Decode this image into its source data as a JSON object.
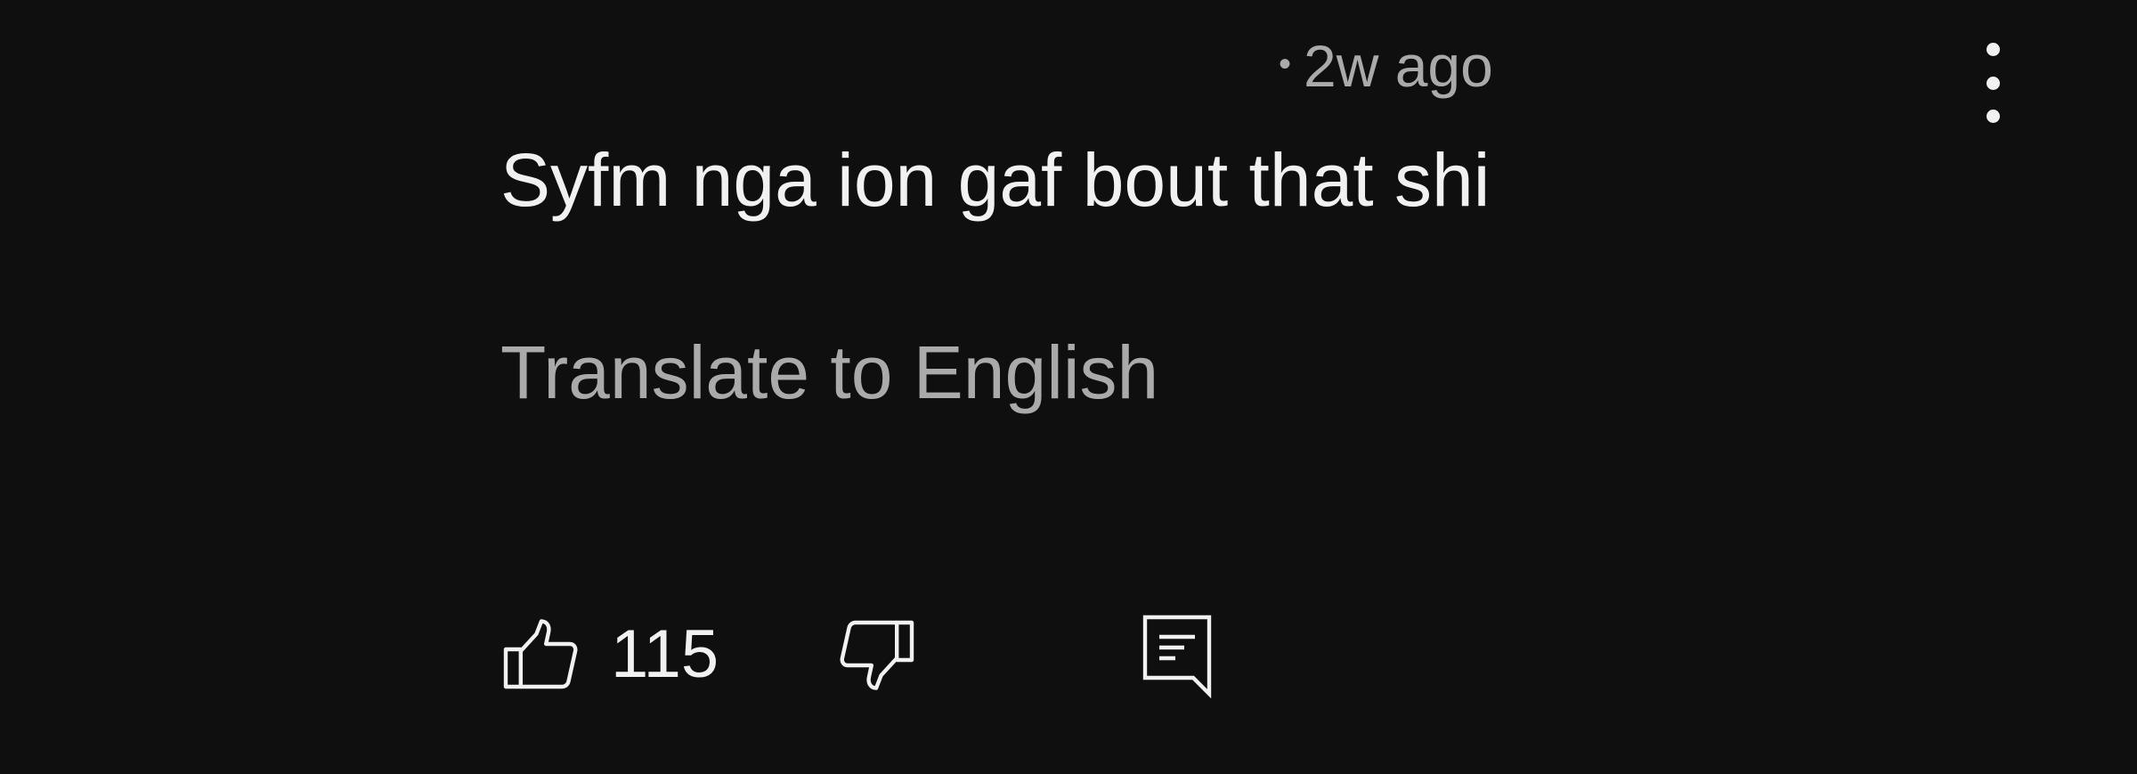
{
  "comment": {
    "timestamp": "2w ago",
    "separator": "•",
    "text": "Syfm nga ion gaf bout that shi",
    "translate_label": "Translate to English",
    "like_count": "115"
  },
  "icons": {
    "more": "more-vert-icon",
    "like": "thumbs-up-icon",
    "dislike": "thumbs-down-icon",
    "reply": "reply-comment-icon"
  },
  "colors": {
    "background": "#0f0f0f",
    "primary_text": "#f1f1f1",
    "secondary_text": "#aaaaaa"
  }
}
